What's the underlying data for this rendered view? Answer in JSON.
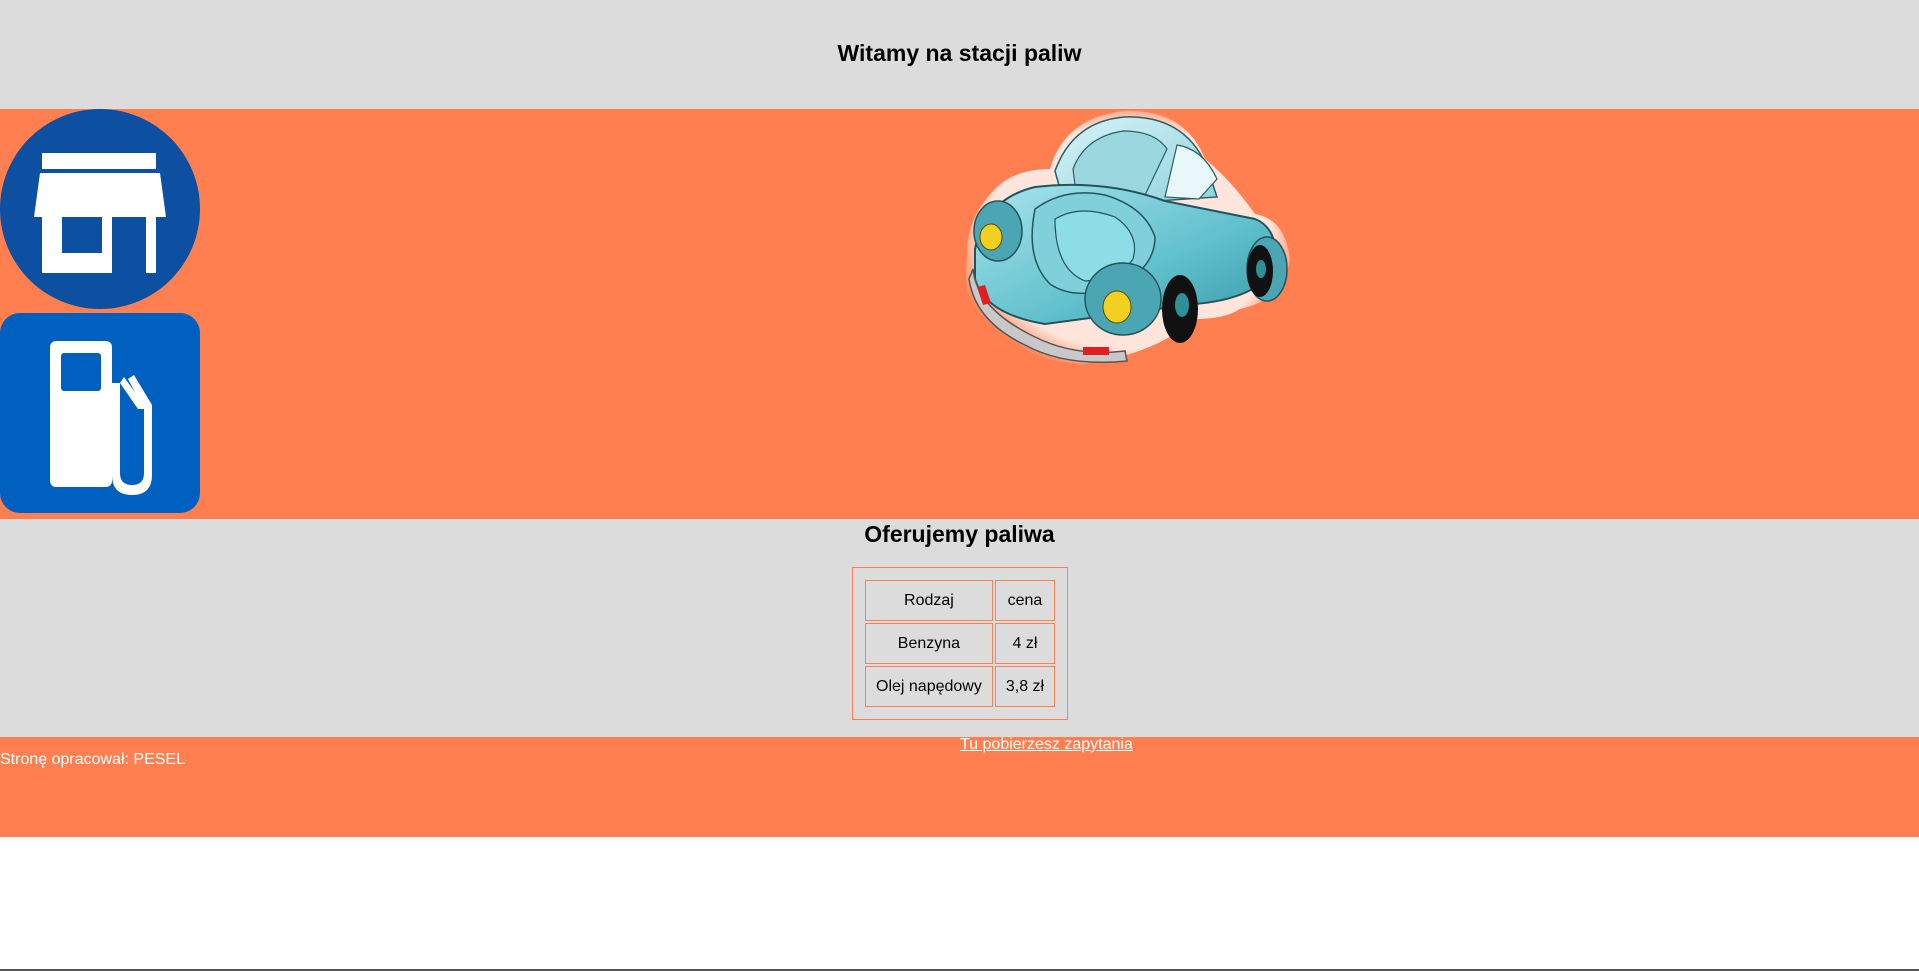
{
  "header": {
    "title": "Witamy na stacji paliw"
  },
  "banner": {
    "icons": [
      "shop-icon",
      "fuel-pump-icon"
    ],
    "image": "car-image"
  },
  "offer": {
    "title": "Oferujemy paliwa",
    "table": {
      "rows": [
        [
          "Rodzaj",
          "cena"
        ],
        [
          "Benzyna",
          "4 zł"
        ],
        [
          "Olej napędowy",
          "3,8 zł"
        ]
      ]
    }
  },
  "footer": {
    "author": "Stronę opracował: PESEL",
    "download_link": "Tu pobierzesz zapytania"
  },
  "colors": {
    "accent": "#ff7f50",
    "panel": "#dcdcdc",
    "icon_blue": "#0057a8"
  }
}
